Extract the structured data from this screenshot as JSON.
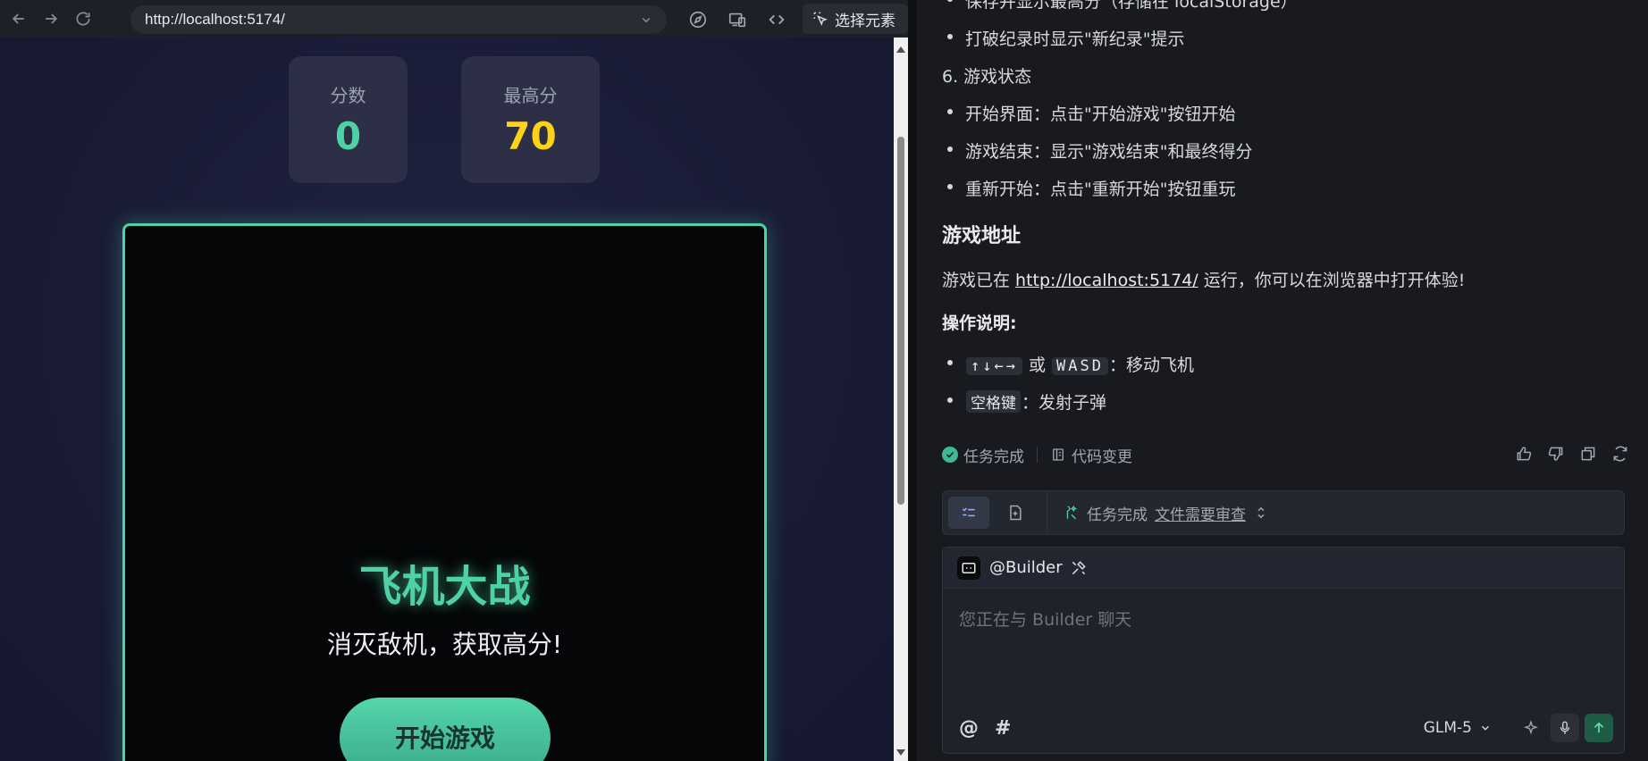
{
  "browser": {
    "url": "http://localhost:5174/",
    "select_element_label": "选择元素"
  },
  "game": {
    "score_label": "分数",
    "score_value": "0",
    "best_label": "最高分",
    "best_value": "70",
    "title": "飞机大战",
    "subtitle": "消灭敌机，获取高分!",
    "start_button": "开始游戏"
  },
  "chat": {
    "lines": {
      "partial_bullet": "保存并显示最高分（存储在 localStorage）",
      "new_record_bullet": "打破纪录时显示\"新纪录\"提示",
      "section6": "6. 游戏状态",
      "start_screen": "开始界面：点击\"开始游戏\"按钮开始",
      "game_over": "游戏结束：显示\"游戏结束\"和最终得分",
      "restart": "重新开始：点击\"重新开始\"按钮重玩",
      "game_address_heading": "游戏地址",
      "address_prefix": "游戏已在 ",
      "address_link": "http://localhost:5174/",
      "address_suffix": " 运行，你可以在浏览器中打开体验!",
      "controls_heading": "操作说明:",
      "arrow_keys": "↑↓←→",
      "or": " 或 ",
      "wasd_keys": "WASD",
      "move_desc": "：移动飞机",
      "space_key": "空格键",
      "fire_desc": "：发射子弹"
    },
    "status": {
      "task_done": "任务完成",
      "code_changes": "代码变更"
    },
    "task_bar": {
      "status_text": "任务完成",
      "review_text": "文件需要审查"
    },
    "input": {
      "agent_name": "@Builder",
      "placeholder": "您正在与 Builder 聊天",
      "at_symbol": "@",
      "hash_symbol": "#",
      "model": "GLM-5"
    }
  },
  "colors": {
    "accent_green": "#4fd1a6",
    "best_score_yellow": "#ffd21a"
  }
}
